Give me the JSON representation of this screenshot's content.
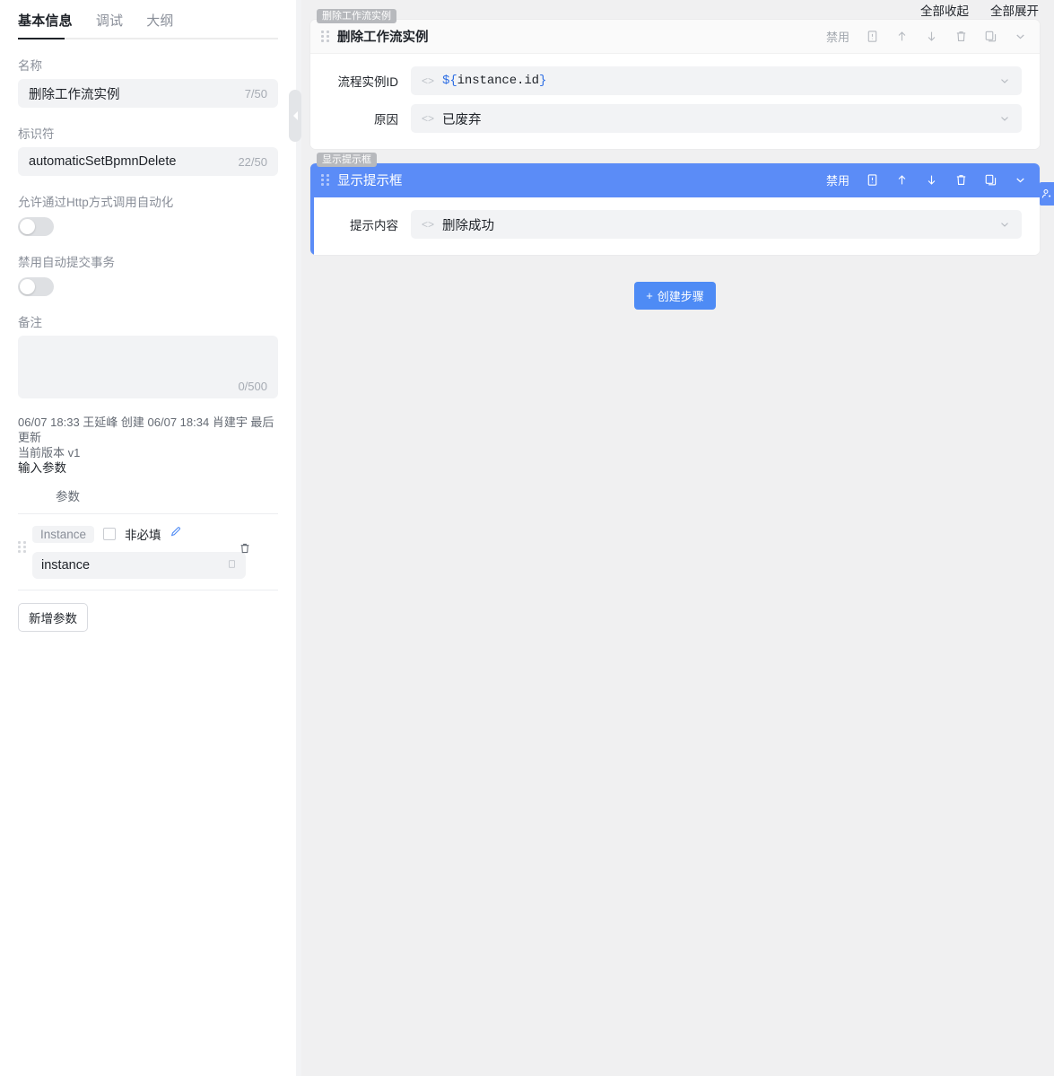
{
  "sidebar": {
    "tabs": [
      {
        "label": "基本信息",
        "active": true
      },
      {
        "label": "调试",
        "active": false
      },
      {
        "label": "大纲",
        "active": false
      }
    ],
    "name_label": "名称",
    "name_value": "删除工作流实例",
    "name_counter": "7/50",
    "identifier_label": "标识符",
    "identifier_value": "automaticSetBpmnDelete",
    "identifier_counter": "22/50",
    "http_toggle_label": "允许通过Http方式调用自动化",
    "http_toggle_on": false,
    "disable_autocommit_label": "禁用自动提交事务",
    "disable_autocommit_on": false,
    "remark_label": "备注",
    "remark_value": "",
    "remark_counter": "0/500",
    "meta_created": "06/07 18:33 王延峰 创建",
    "meta_updated": "06/07 18:34 肖建宇 最后更新",
    "meta_version": "当前版本 v1",
    "input_params_title": "输入参数",
    "param_column_header": "参数",
    "params": [
      {
        "type_pill": "Instance",
        "optional_label": "非必填",
        "optional_checked": false,
        "value": "instance",
        "edit_icon": "pencil-icon",
        "suffix_icon": "copy-icon",
        "delete_icon": "trash-icon"
      }
    ],
    "add_param_label": "新增参数"
  },
  "main": {
    "collapse_all_label": "全部收起",
    "expand_all_label": "全部展开",
    "add_step_label": "创建步骤",
    "add_step_plus": "+",
    "header_actions": {
      "disable_label": "禁用",
      "icons": [
        "note-icon",
        "arrow-up-icon",
        "arrow-down-icon",
        "trash-icon",
        "copy-icon",
        "chevron-down-icon"
      ]
    },
    "side_tab_icon": "add-user-icon",
    "steps": [
      {
        "badge": "删除工作流实例",
        "title": "删除工作流实例",
        "selected": false,
        "fields": [
          {
            "label": "流程实例ID",
            "value_prefix": "${",
            "value_core": "instance.id",
            "value_suffix": "}",
            "is_code": true
          },
          {
            "label": "原因",
            "value": "已废弃",
            "is_code": false
          }
        ]
      },
      {
        "badge": "显示提示框",
        "title": "显示提示框",
        "selected": true,
        "fields": [
          {
            "label": "提示内容",
            "value": "删除成功",
            "is_code": false
          }
        ]
      }
    ]
  },
  "colors": {
    "accent": "#5b8cf7",
    "button": "#4e8bf5",
    "code_bracket": "#2f6fe4",
    "field_bg": "#f2f3f5",
    "main_bg": "#f0f0f1",
    "badge_bg": "#b7b9bd"
  }
}
